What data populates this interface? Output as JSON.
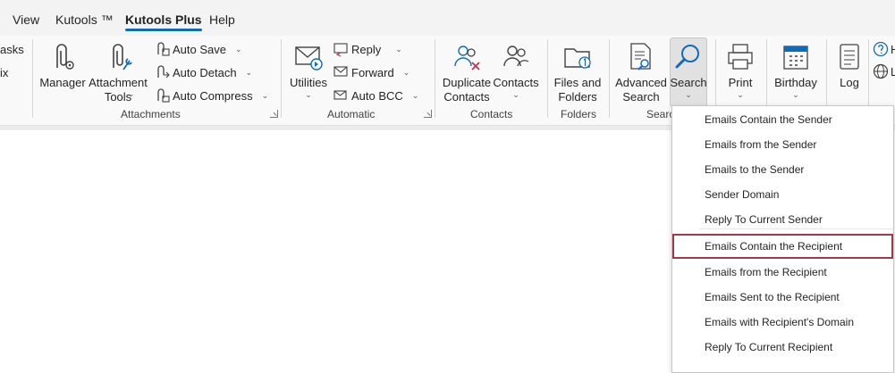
{
  "menu": {
    "tabs": [
      {
        "label": "View"
      },
      {
        "label": "Kutools ™"
      },
      {
        "label": "Kutools Plus"
      },
      {
        "label": "Help"
      }
    ],
    "active_tab": "Kutools Plus"
  },
  "left_clipped": {
    "top": "asks",
    "bottom": "ix"
  },
  "groups": {
    "attachments": {
      "label": "Attachments",
      "manager": "Manager",
      "attachment_tools_line1": "Attachment",
      "attachment_tools_line2": "Tools",
      "auto_save": "Auto Save",
      "auto_detach": "Auto Detach",
      "auto_compress": "Auto Compress"
    },
    "automatic": {
      "label": "Automatic",
      "utilities": "Utilities",
      "reply": "Reply",
      "forward": "Forward",
      "auto_bcc": "Auto BCC"
    },
    "contacts": {
      "label": "Contacts",
      "duplicate_line1": "Duplicate",
      "duplicate_line2": "Contacts",
      "contacts": "Contacts"
    },
    "folders": {
      "label": "Folders",
      "files_line1": "Files and",
      "files_line2": "Folders"
    },
    "search": {
      "label": "Searc",
      "advanced_line1": "Advanced",
      "advanced_line2": "Search",
      "search": "Search"
    },
    "other": {
      "print": "Print",
      "birthday": "Birthday",
      "log": "Log"
    }
  },
  "dropdown": {
    "items": [
      {
        "label": "Emails Contain the Sender"
      },
      {
        "label": "Emails from the Sender"
      },
      {
        "label": "Emails to the Sender"
      },
      {
        "label": "Sender Domain"
      },
      {
        "label": "Reply To Current Sender"
      },
      {
        "label": "Emails Contain the Recipient"
      },
      {
        "label": "Emails from the Recipient"
      },
      {
        "label": "Emails Sent to the Recipient"
      },
      {
        "label": "Emails with Recipient's Domain"
      },
      {
        "label": "Reply To Current Recipient"
      }
    ],
    "highlighted_index": 5
  },
  "colors": {
    "accent": "#0f6cbd",
    "highlight_border": "#a6374a"
  }
}
